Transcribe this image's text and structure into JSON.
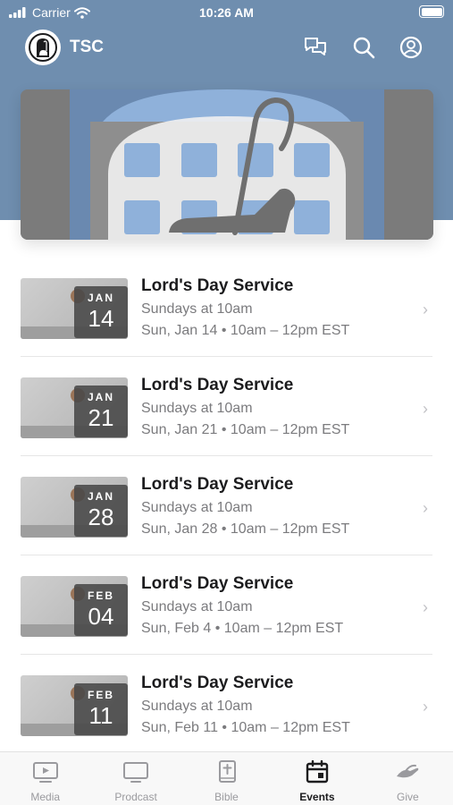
{
  "status_bar": {
    "carrier": "Carrier",
    "time": "10:26 AM"
  },
  "app_bar": {
    "org_name": "TSC"
  },
  "events": [
    {
      "month": "JAN",
      "day": "14",
      "title": "Lord's Day Service",
      "subtitle": "Sundays at 10am",
      "when": "Sun, Jan 14 • 10am – 12pm EST"
    },
    {
      "month": "JAN",
      "day": "21",
      "title": "Lord's Day Service",
      "subtitle": "Sundays at 10am",
      "when": "Sun, Jan 21 • 10am – 12pm EST"
    },
    {
      "month": "JAN",
      "day": "28",
      "title": "Lord's Day Service",
      "subtitle": "Sundays at 10am",
      "when": "Sun, Jan 28 • 10am – 12pm EST"
    },
    {
      "month": "FEB",
      "day": "04",
      "title": "Lord's Day Service",
      "subtitle": "Sundays at 10am",
      "when": "Sun, Feb 4 • 10am – 12pm EST"
    },
    {
      "month": "FEB",
      "day": "11",
      "title": "Lord's Day Service",
      "subtitle": "Sundays at 10am",
      "when": "Sun, Feb 11 • 10am – 12pm EST"
    }
  ],
  "tabs": [
    {
      "label": "Media",
      "icon": "media-play-icon",
      "active": false
    },
    {
      "label": "Prodcast",
      "icon": "tv-icon",
      "active": false
    },
    {
      "label": "Bible",
      "icon": "bible-icon",
      "active": false
    },
    {
      "label": "Events",
      "icon": "calendar-icon",
      "active": true
    },
    {
      "label": "Give",
      "icon": "give-hand-icon",
      "active": false
    }
  ],
  "colors": {
    "header": "#6f8eaf",
    "banner_accent": "#8fb1da",
    "active_tab": "#1c1c1e",
    "inactive_tab": "#9a9a9e"
  }
}
